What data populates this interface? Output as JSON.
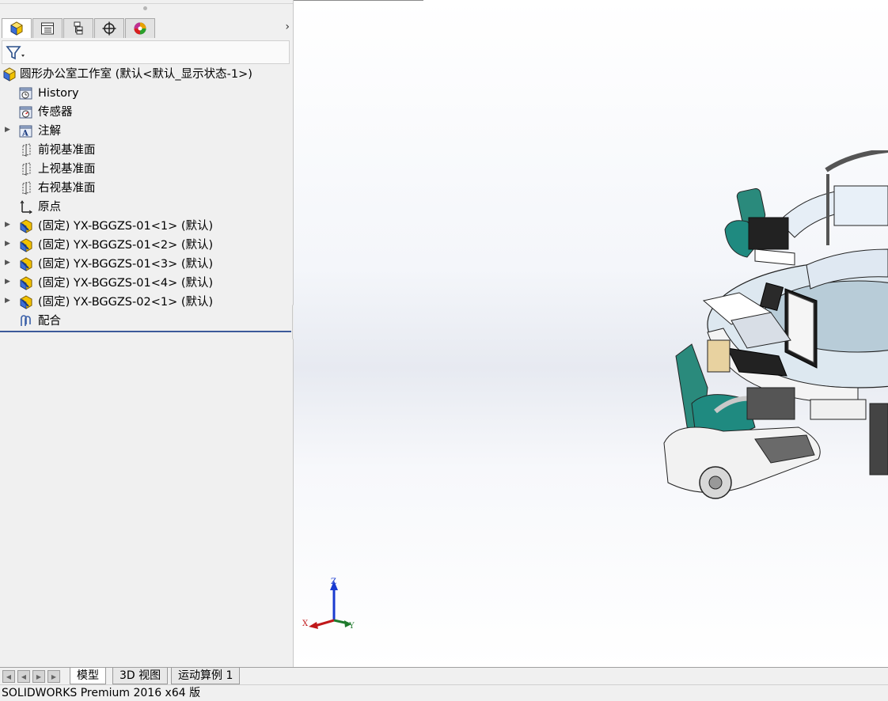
{
  "feature_manager": {
    "tabs": [
      {
        "name": "FeatureManager design tree",
        "icon": "feature-tree-icon"
      },
      {
        "name": "PropertyManager",
        "icon": "property-manager-icon"
      },
      {
        "name": "ConfigurationManager",
        "icon": "configuration-manager-icon"
      },
      {
        "name": "DimXpertManager",
        "icon": "dimxpert-icon"
      },
      {
        "name": "DisplayManager",
        "icon": "display-manager-icon"
      }
    ],
    "scroll_right_glyph": "›",
    "filter_icon": "filter-icon",
    "tree": {
      "root_label": "圆形办公室工作室  (默认<默认_显示状态-1>)",
      "items": [
        {
          "label": "History",
          "icon": "history-icon",
          "expandable": false
        },
        {
          "label": "传感器",
          "icon": "sensor-icon",
          "expandable": false
        },
        {
          "label": "注解",
          "icon": "annotation-icon",
          "expandable": true
        },
        {
          "label": "前视基准面",
          "icon": "plane-icon",
          "expandable": false
        },
        {
          "label": "上视基准面",
          "icon": "plane-icon",
          "expandable": false
        },
        {
          "label": "右视基准面",
          "icon": "plane-icon",
          "expandable": false
        },
        {
          "label": "原点",
          "icon": "origin-icon",
          "expandable": false
        },
        {
          "label": "(固定) YX-BGGZS-01<1> (默认)",
          "icon": "subassembly-icon",
          "expandable": true
        },
        {
          "label": "(固定) YX-BGGZS-01<2> (默认)",
          "icon": "subassembly-icon",
          "expandable": true
        },
        {
          "label": "(固定) YX-BGGZS-01<3> (默认)",
          "icon": "subassembly-icon",
          "expandable": true
        },
        {
          "label": "(固定) YX-BGGZS-01<4> (默认)",
          "icon": "subassembly-icon",
          "expandable": true
        },
        {
          "label": "(固定) YX-BGGZS-02<1> (默认)",
          "icon": "subassembly-icon",
          "expandable": true
        },
        {
          "label": "配合",
          "icon": "mates-icon",
          "expandable": false
        }
      ]
    }
  },
  "viewport": {
    "triad": {
      "x_label": "X",
      "y_label": "Y",
      "z_label": "Z"
    },
    "colors": {
      "x_axis": "#c0181a",
      "y_axis": "#1e7a2c",
      "z_axis": "#1a3bd0",
      "chair_teal": "#1f8a80"
    }
  },
  "bottom_tabs": {
    "tabs": [
      "模型",
      "3D 视图",
      "运动算例 1"
    ],
    "active_index": 0
  },
  "status_bar": {
    "text": "SOLIDWORKS Premium 2016 x64 版"
  }
}
